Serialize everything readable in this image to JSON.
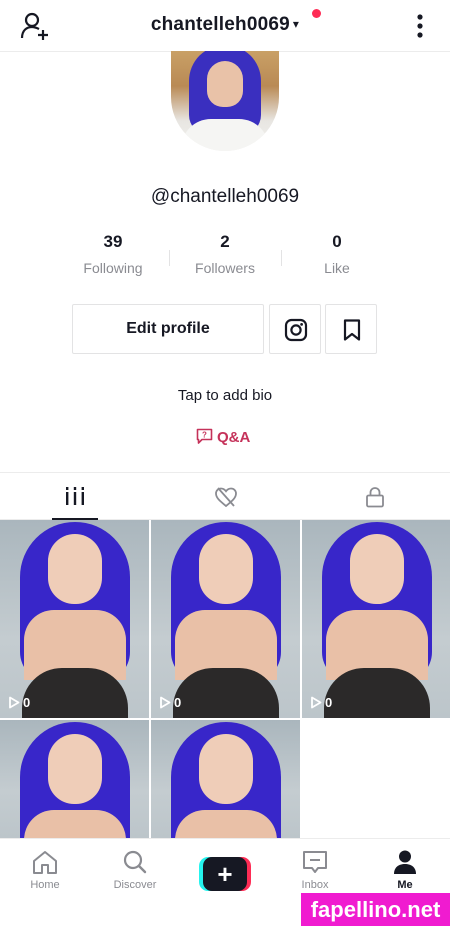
{
  "header": {
    "username": "chantelleh0069",
    "caret": "▾",
    "icons": [
      "add-user-icon",
      "more-vertical-icon"
    ],
    "notification_color": "#fe2c55"
  },
  "profile": {
    "handle": "@chantelleh0069"
  },
  "stats": [
    {
      "value": "39",
      "label": "Following"
    },
    {
      "value": "2",
      "label": "Followers"
    },
    {
      "value": "0",
      "label": "Like"
    }
  ],
  "actions": {
    "edit_label": "Edit profile",
    "icons": [
      "instagram-icon",
      "bookmark-icon"
    ]
  },
  "bio": {
    "placeholder": "Tap to add bio"
  },
  "qa": {
    "label": "Q&A",
    "color": "#c5325a"
  },
  "tabs": {
    "icons": [
      "videos-grid-icon",
      "liked-videos-icon",
      "private-lock-icon"
    ],
    "active": "videos-grid-icon"
  },
  "videos": [
    {
      "views": "0"
    },
    {
      "views": "0"
    },
    {
      "views": "0"
    },
    {
      "views": ""
    },
    {
      "views": ""
    }
  ],
  "bottom_nav": {
    "home": "Home",
    "discover": "Discover",
    "create": "+",
    "inbox": "Inbox",
    "me": "Me",
    "accent_colors": [
      "#25f4ee",
      "#fe2c55"
    ]
  },
  "watermark": {
    "text": "fapellino.net",
    "color": "#f01bd0"
  }
}
